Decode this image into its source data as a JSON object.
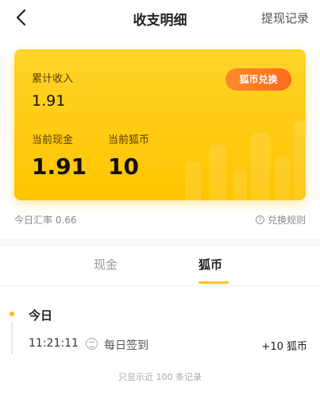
{
  "nav": {
    "title": "收支明细",
    "right_label": "提现记录"
  },
  "card": {
    "total_income_label": "累计收入",
    "total_income_value": "1.91",
    "current_cash_label": "当前现金",
    "current_cash_value": "1.91",
    "current_coin_label": "当前狐币",
    "current_coin_value": "10",
    "exchange_button": "狐币兑换",
    "colors": {
      "card_top": "#ffd42a",
      "card_bottom": "#ffc400",
      "button": "#ff7a22"
    }
  },
  "rate": {
    "today_rate": "今日汇率 0.66",
    "rules_link": "兑换规则"
  },
  "tabs": [
    {
      "label": "现金",
      "active": false
    },
    {
      "label": "狐币",
      "active": true
    }
  ],
  "timeline": {
    "day": "今日",
    "records": [
      {
        "time": "11:21:11",
        "icon": "checkin-icon",
        "description": "每日签到",
        "amount": "+10 狐币"
      }
    ]
  },
  "footer_note": "只显示近 100 条记录"
}
